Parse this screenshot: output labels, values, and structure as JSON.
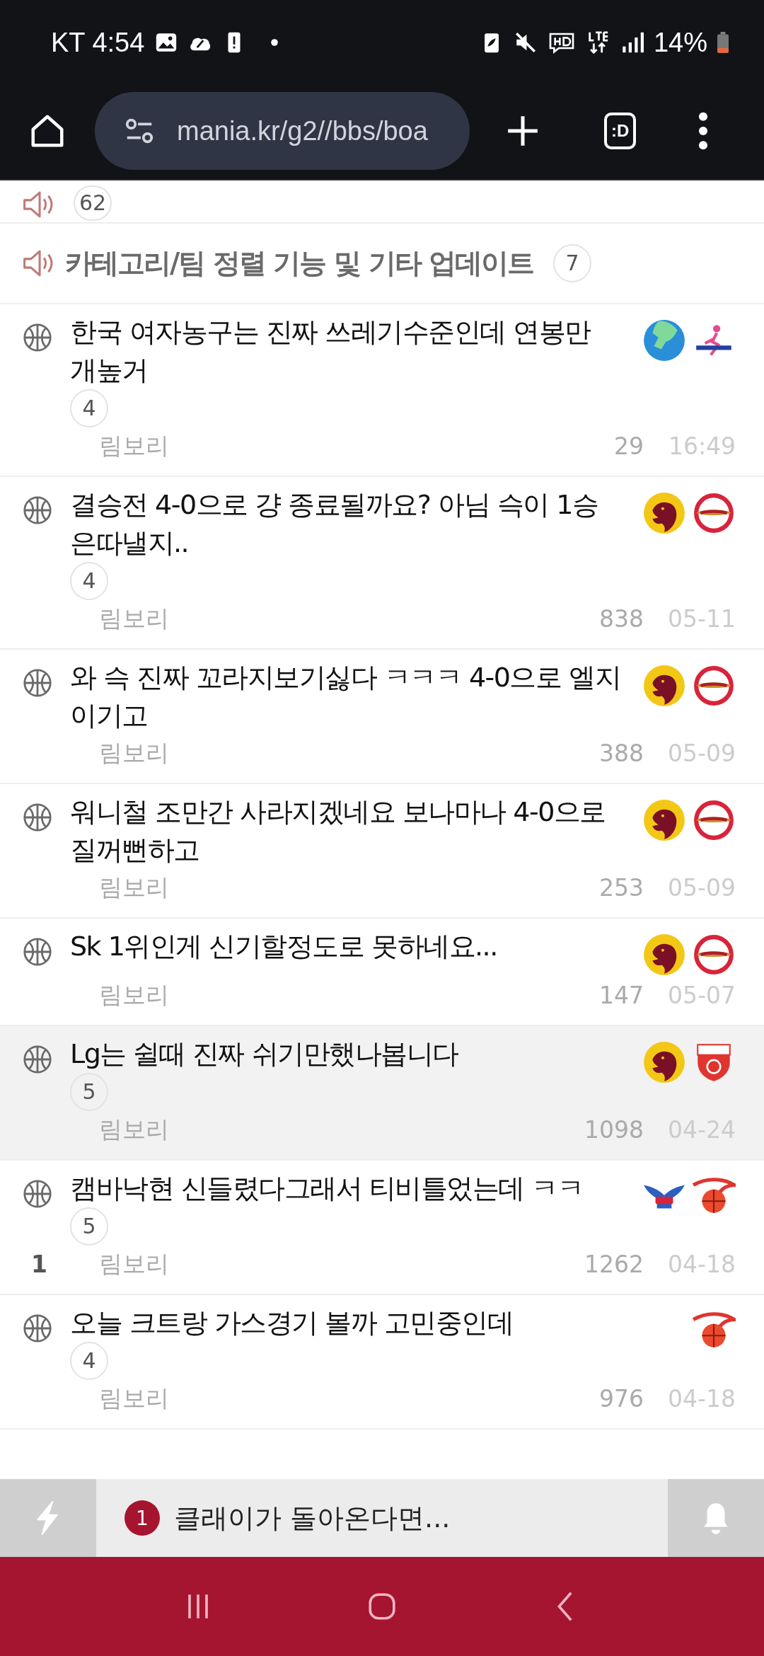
{
  "status_bar": {
    "carrier_time": "KT 4:54",
    "battery": "14%"
  },
  "browser": {
    "url": "mania.kr/g2//bbs/boa",
    "tabs_label": ":D"
  },
  "notices": [
    {
      "count": "62"
    },
    {
      "title": "카테고리/팀 정렬 기능 및 기타 업데이트",
      "count": "7"
    }
  ],
  "posts": [
    {
      "title": "한국 여자농구는 진짜 쓰레기수준인데 연봉만 개높거",
      "comments": "4",
      "author": "림보리",
      "views": "29",
      "date": "16:49",
      "highlighted": false,
      "logos": [
        {
          "kind": "globe"
        },
        {
          "kind": "figure"
        }
      ]
    },
    {
      "title": "결승전 4-0으로 걍 종료될까요? 아님 슥이 1승은따낼지..",
      "comments": "4",
      "author": "림보리",
      "views": "838",
      "date": "05-11",
      "highlighted": false,
      "logos": [
        {
          "kind": "hawk"
        },
        {
          "kind": "knights"
        }
      ]
    },
    {
      "title": "와 슥 진짜 꼬라지보기싫다 ㅋㅋㅋ 4-0으로 엘지이기고",
      "author": "림보리",
      "views": "388",
      "date": "05-09",
      "highlighted": false,
      "logos": [
        {
          "kind": "hawk"
        },
        {
          "kind": "knights"
        }
      ]
    },
    {
      "title": "워니철 조만간 사라지겠네요 보나마나 4-0으로 질꺼뻔하고",
      "author": "림보리",
      "views": "253",
      "date": "05-09",
      "highlighted": false,
      "logos": [
        {
          "kind": "hawk"
        },
        {
          "kind": "knights"
        }
      ]
    },
    {
      "title": "Sk 1위인게 신기할정도로 못하네요...",
      "author": "림보리",
      "views": "147",
      "date": "05-07",
      "highlighted": false,
      "logos": [
        {
          "kind": "hawk"
        },
        {
          "kind": "knights"
        }
      ]
    },
    {
      "title": "Lg는 쉴때 진짜 쉬기만했나봅니다",
      "comments": "5",
      "author": "림보리",
      "views": "1098",
      "date": "04-24",
      "highlighted": true,
      "logos": [
        {
          "kind": "hawk"
        },
        {
          "kind": "shield"
        }
      ]
    },
    {
      "title": "캠바낙현 신들렸다그래서 티비틀었는데 ㅋㅋ",
      "comments": "5",
      "rank": "1",
      "author": "림보리",
      "views": "1262",
      "date": "04-18",
      "highlighted": false,
      "logos": [
        {
          "kind": "wings"
        },
        {
          "kind": "ball"
        }
      ]
    },
    {
      "title": "오늘 크트랑 가스경기 볼까 고민중인데",
      "comments": "4",
      "author": "림보리",
      "views": "976",
      "date": "04-18",
      "highlighted": false,
      "logos": [
        {
          "kind": "ball"
        }
      ]
    }
  ],
  "ticker": {
    "badge": "1",
    "text": "클래이가 돌아온다면..."
  }
}
